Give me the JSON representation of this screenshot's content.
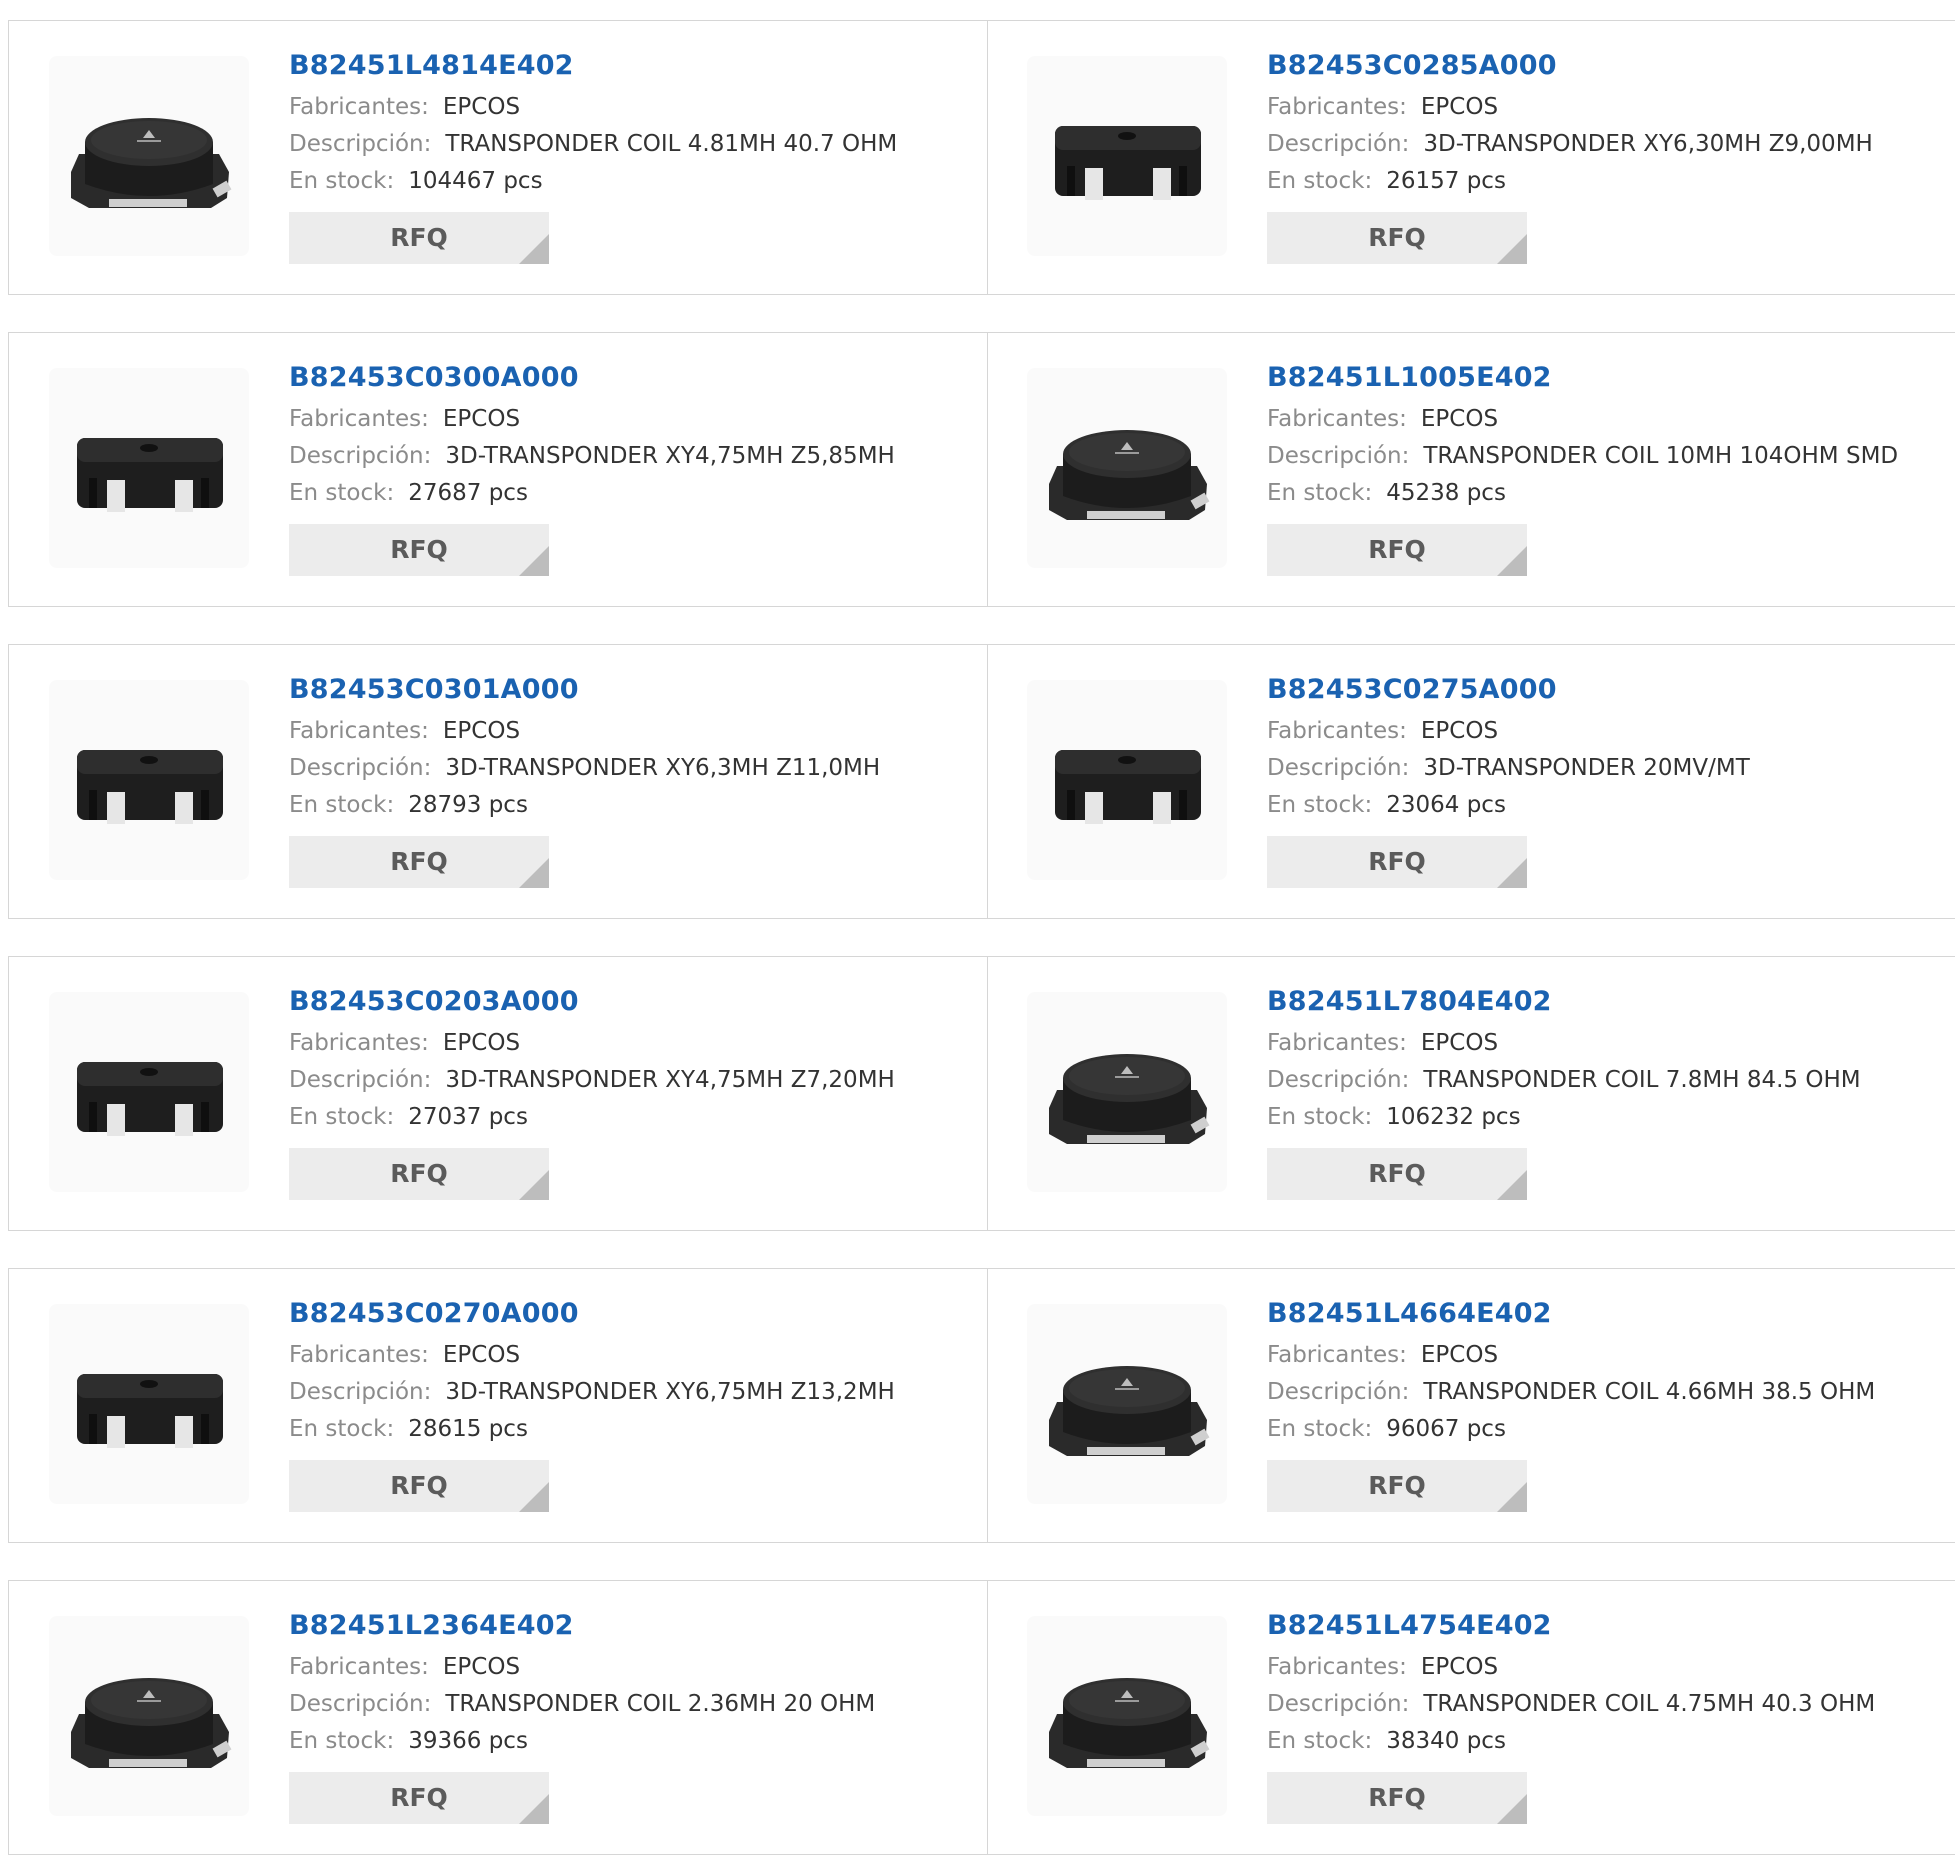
{
  "labels": {
    "manufacturer": "Fabricantes:",
    "description": "Descripción:",
    "stock": "En stock:",
    "rfq": "RFQ"
  },
  "colors": {
    "part_link": "#1a62b1",
    "rfq_bg": "#ececec",
    "rfq_text": "#5b5b5b",
    "border": "#d6d6d6"
  },
  "products": [
    {
      "part": "B82451L4814E402",
      "manufacturer": "EPCOS",
      "description": "TRANSPONDER COIL 4.81MH 40.7 OHM",
      "stock": "104467 pcs",
      "image": "coil-inductor-image"
    },
    {
      "part": "B82453C0285A000",
      "manufacturer": "EPCOS",
      "description": "3D-TRANSPONDER XY6,30MH Z9,00MH",
      "stock": "26157 pcs",
      "image": "3d-transponder-image"
    },
    {
      "part": "B82453C0300A000",
      "manufacturer": "EPCOS",
      "description": "3D-TRANSPONDER XY4,75MH Z5,85MH",
      "stock": "27687 pcs",
      "image": "3d-transponder-image"
    },
    {
      "part": "B82451L1005E402",
      "manufacturer": "EPCOS",
      "description": "TRANSPONDER COIL 10MH 104OHM SMD",
      "stock": "45238 pcs",
      "image": "coil-inductor-image"
    },
    {
      "part": "B82453C0301A000",
      "manufacturer": "EPCOS",
      "description": "3D-TRANSPONDER XY6,3MH Z11,0MH",
      "stock": "28793 pcs",
      "image": "3d-transponder-image"
    },
    {
      "part": "B82453C0275A000",
      "manufacturer": "EPCOS",
      "description": "3D-TRANSPONDER 20MV/MT",
      "stock": "23064 pcs",
      "image": "3d-transponder-image"
    },
    {
      "part": "B82453C0203A000",
      "manufacturer": "EPCOS",
      "description": "3D-TRANSPONDER XY4,75MH Z7,20MH",
      "stock": "27037 pcs",
      "image": "3d-transponder-image"
    },
    {
      "part": "B82451L7804E402",
      "manufacturer": "EPCOS",
      "description": "TRANSPONDER COIL 7.8MH 84.5 OHM",
      "stock": "106232 pcs",
      "image": "coil-inductor-image"
    },
    {
      "part": "B82453C0270A000",
      "manufacturer": "EPCOS",
      "description": "3D-TRANSPONDER XY6,75MH Z13,2MH",
      "stock": "28615 pcs",
      "image": "3d-transponder-image"
    },
    {
      "part": "B82451L4664E402",
      "manufacturer": "EPCOS",
      "description": "TRANSPONDER COIL 4.66MH 38.5 OHM",
      "stock": "96067 pcs",
      "image": "coil-inductor-image"
    },
    {
      "part": "B82451L2364E402",
      "manufacturer": "EPCOS",
      "description": "TRANSPONDER COIL 2.36MH 20 OHM",
      "stock": "39366 pcs",
      "image": "coil-inductor-image"
    },
    {
      "part": "B82451L4754E402",
      "manufacturer": "EPCOS",
      "description": "TRANSPONDER COIL 4.75MH 40.3 OHM",
      "stock": "38340 pcs",
      "image": "coil-inductor-image"
    }
  ]
}
